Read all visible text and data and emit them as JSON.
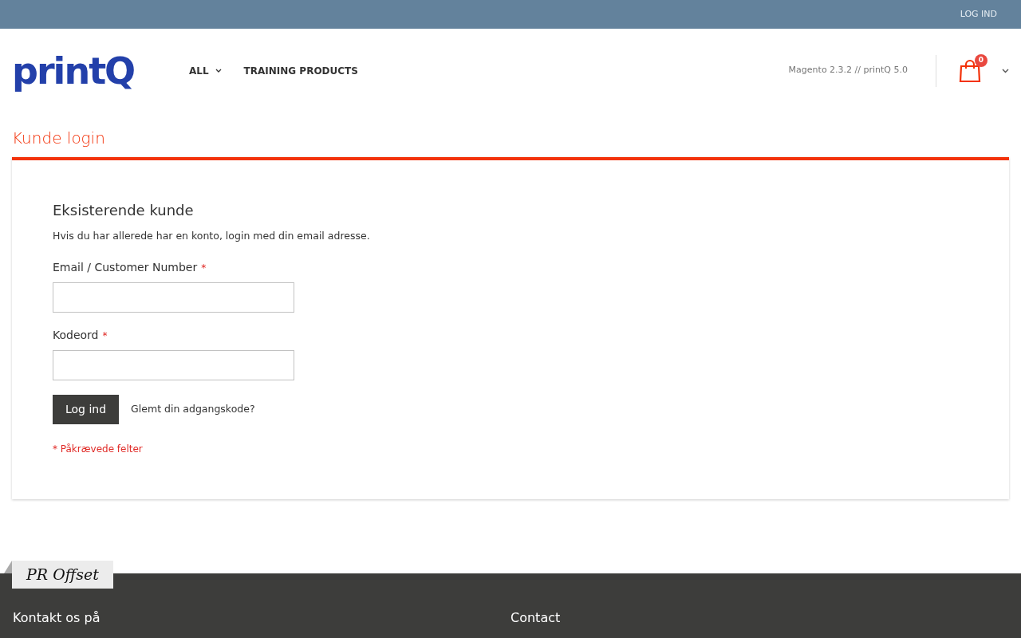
{
  "top_bar": {
    "login_link": "LOG IND"
  },
  "header": {
    "logo": "printQ",
    "nav": [
      {
        "label": "ALL",
        "has_dropdown": true
      },
      {
        "label": "TRAINING PRODUCTS",
        "has_dropdown": false
      }
    ],
    "version": "Magento 2.3.2 // printQ 5.0",
    "cart": {
      "count": "0"
    }
  },
  "page_title": "Kunde login",
  "login": {
    "heading": "Eksisterende kunde",
    "intro": "Hvis du har allerede har en konto, login med din email adresse.",
    "fields": [
      {
        "label": "Email / Customer Number",
        "required_mark": "*"
      },
      {
        "label": "Kodeord",
        "required_mark": "*"
      }
    ],
    "submit": "Log ind",
    "forgot_link": "Glemt din adgangskode?",
    "required_note": "* Påkrævede felter"
  },
  "footer": {
    "tab": "PR Offset",
    "columns": [
      {
        "heading": "Kontakt os på"
      },
      {
        "heading": "Contact"
      }
    ]
  }
}
